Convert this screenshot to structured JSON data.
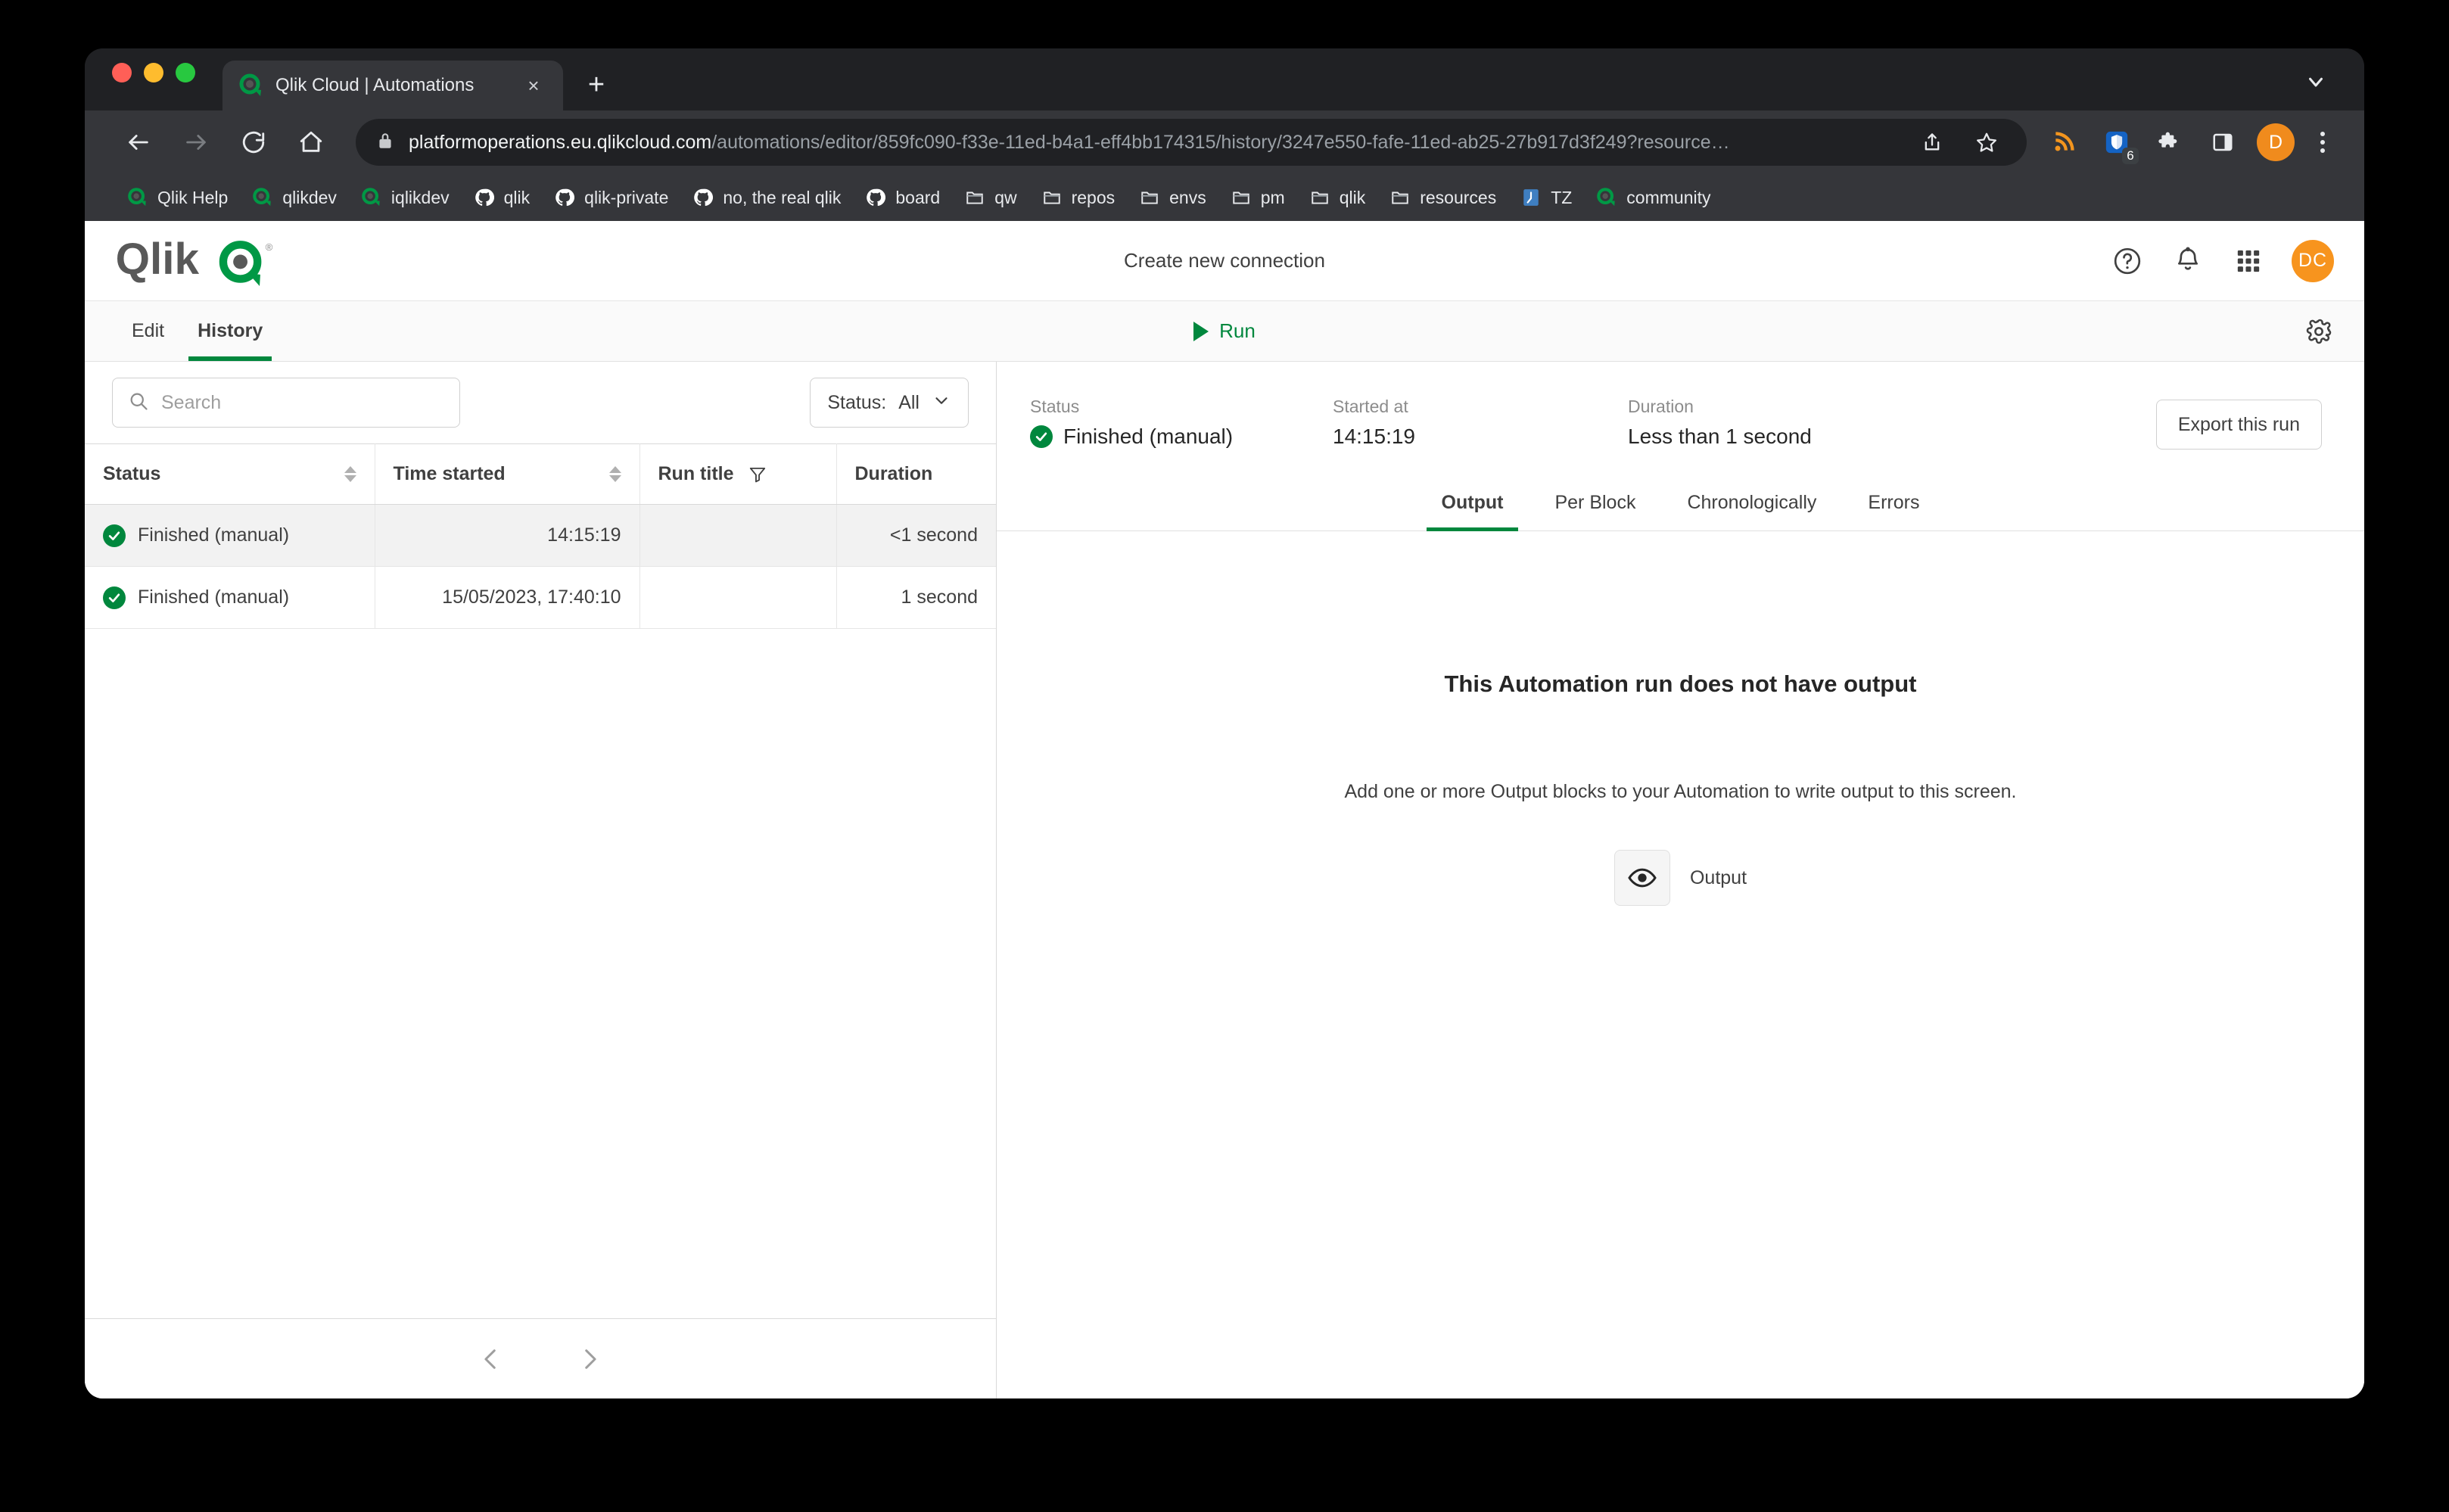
{
  "browser": {
    "tab": {
      "title": "Qlik Cloud | Automations",
      "favicon": "qlik-icon",
      "close_label": "×"
    },
    "new_tab_label": "+",
    "url": {
      "domain": "platformoperations.eu.qlikcloud.com",
      "path": "/automations/editor/859fc090-f33e-11ed-b4a1-eff4bb174315/history/3247e550-fafe-11ed-ab25-27b917d3f249?resource…"
    },
    "extension_badge": "6",
    "profile_initial": "D",
    "bookmarks": [
      {
        "label": "Qlik Help",
        "icon": "qlik-icon"
      },
      {
        "label": "qlikdev",
        "icon": "qlik-icon"
      },
      {
        "label": "iqlikdev",
        "icon": "qlik-icon"
      },
      {
        "label": "qlik",
        "icon": "github-icon"
      },
      {
        "label": "qlik-private",
        "icon": "github-icon"
      },
      {
        "label": "no, the real qlik",
        "icon": "github-icon"
      },
      {
        "label": "board",
        "icon": "github-icon"
      },
      {
        "label": "qw",
        "icon": "folder-icon"
      },
      {
        "label": "repos",
        "icon": "folder-icon"
      },
      {
        "label": "envs",
        "icon": "folder-icon"
      },
      {
        "label": "pm",
        "icon": "folder-icon"
      },
      {
        "label": "qlik",
        "icon": "folder-icon"
      },
      {
        "label": "resources",
        "icon": "folder-icon"
      },
      {
        "label": "TZ",
        "icon": "clock-icon"
      },
      {
        "label": "community",
        "icon": "qlik-icon"
      }
    ]
  },
  "app": {
    "brand": "Qlik",
    "title": "Create new connection",
    "avatar_initials": "DC",
    "tabs": [
      {
        "label": "Edit",
        "active": false
      },
      {
        "label": "History",
        "active": true
      }
    ],
    "run_label": "Run"
  },
  "left_panel": {
    "search": {
      "placeholder": "Search",
      "value": ""
    },
    "status_filter": {
      "label": "Status:",
      "value": "All"
    },
    "columns": [
      {
        "label": "Status",
        "sortable": true
      },
      {
        "label": "Time started",
        "sortable": true
      },
      {
        "label": "Run title",
        "filterable": true
      },
      {
        "label": "Duration",
        "sortable": false
      }
    ],
    "rows": [
      {
        "status": "Finished (manual)",
        "time_started": "14:15:19",
        "run_title": "",
        "duration": "<1 second",
        "selected": true
      },
      {
        "status": "Finished (manual)",
        "time_started": "15/05/2023, 17:40:10",
        "run_title": "",
        "duration": "1 second",
        "selected": false
      }
    ]
  },
  "right_panel": {
    "summary": {
      "status_label": "Status",
      "status_value": "Finished (manual)",
      "started_label": "Started at",
      "started_value": "14:15:19",
      "duration_label": "Duration",
      "duration_value": "Less than 1 second"
    },
    "export_label": "Export this run",
    "tabs": [
      {
        "label": "Output",
        "active": true
      },
      {
        "label": "Per Block",
        "active": false
      },
      {
        "label": "Chronologically",
        "active": false
      },
      {
        "label": "Errors",
        "active": false
      }
    ],
    "empty_state": {
      "title": "This Automation run does not have output",
      "subtitle": "Add one or more Output blocks to your Automation to write output to this screen.",
      "cta_label": "Output"
    }
  },
  "colors": {
    "qlik_green": "#00873d",
    "avatar_orange": "#f7941e",
    "browser_chrome": "#35363a"
  }
}
